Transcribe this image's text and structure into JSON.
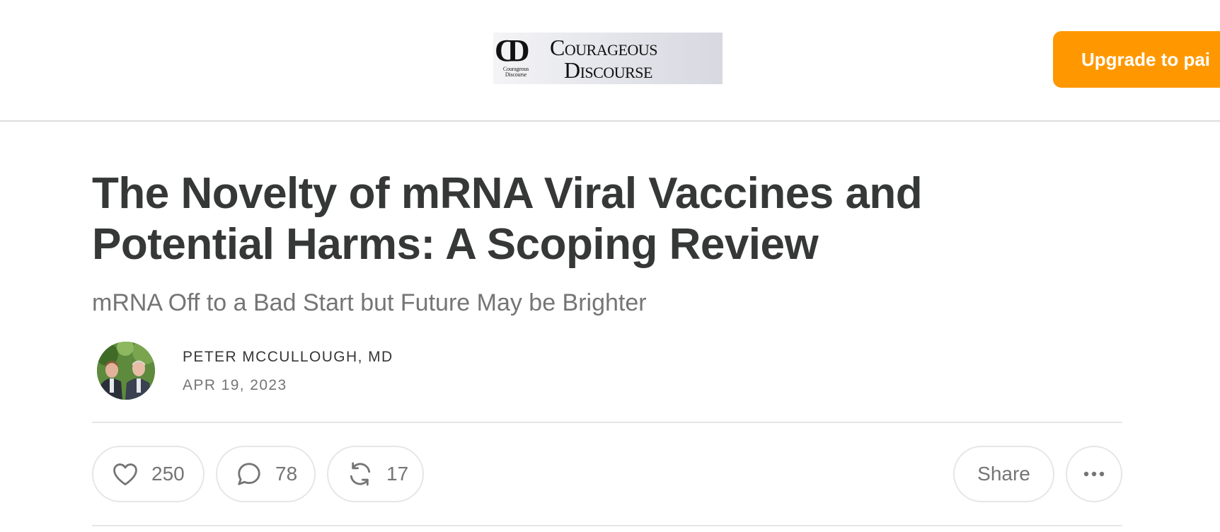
{
  "header": {
    "logo": {
      "monogram": "CD",
      "monogram_caption_line1": "Courageous",
      "monogram_caption_line2": "Discourse",
      "wordmark_line1": "Courageous",
      "wordmark_line2": "Discourse"
    },
    "upgrade_label": "Upgrade to pai"
  },
  "post": {
    "title_line1": "The Novelty of mRNA Viral Vaccines and",
    "title_line2": "Potential Harms: A Scoping Review",
    "subtitle": "mRNA Off to a Bad Start but Future May be Brighter",
    "author": "PETER MCCULLOUGH, MD",
    "date": "APR 19, 2023"
  },
  "actions": {
    "like_icon": "heart-icon",
    "like_count": "250",
    "comment_icon": "speech-bubble-icon",
    "comment_count": "78",
    "restack_icon": "restack-arrows-icon",
    "restack_count": "17",
    "share_label": "Share",
    "more_icon": "ellipsis-icon"
  },
  "colors": {
    "accent": "#ff9800",
    "text": "#363737",
    "muted": "#757575",
    "divider": "#e6e6e6"
  }
}
